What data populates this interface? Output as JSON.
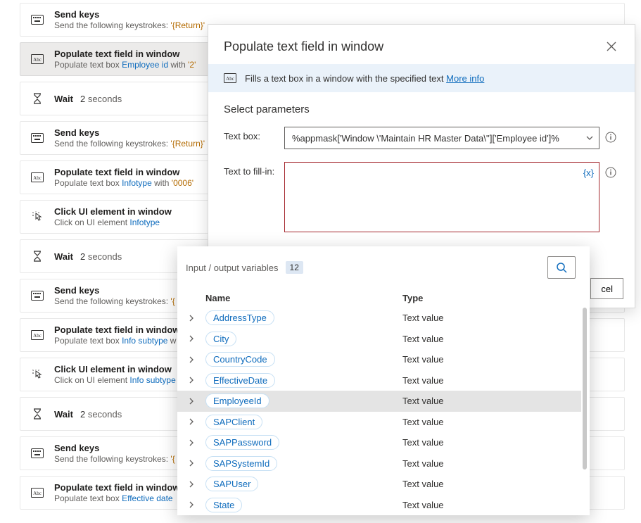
{
  "flow": [
    {
      "kind": "sendkeys",
      "title": "Send keys",
      "prefix": "Send the following keystrokes: ",
      "keys": "'{Return}'"
    },
    {
      "kind": "populate",
      "title": "Populate text field in window",
      "prefix": "Populate text box ",
      "link": "Employee id",
      "mid": " with ",
      "lit": "'2'",
      "selected": true
    },
    {
      "kind": "wait",
      "title": "Wait",
      "seconds": "2",
      "suffix": "seconds"
    },
    {
      "kind": "sendkeys",
      "title": "Send keys",
      "prefix": "Send the following keystrokes: ",
      "keys": "'{Return}'"
    },
    {
      "kind": "populate",
      "title": "Populate text field in window",
      "prefix": "Populate text box ",
      "link": "Infotype",
      "mid": " with ",
      "lit": "'0006'"
    },
    {
      "kind": "click",
      "title": "Click UI element in window",
      "prefix": "Click on UI element ",
      "link": "Infotype"
    },
    {
      "kind": "wait",
      "title": "Wait",
      "seconds": "2",
      "suffix": "seconds"
    },
    {
      "kind": "sendkeys",
      "title": "Send keys",
      "prefix": "Send the following keystrokes: ",
      "keys": "'{"
    },
    {
      "kind": "populate",
      "title": "Populate text field in window",
      "prefix": "Populate text box ",
      "link": "Info subtype",
      "mid": " w"
    },
    {
      "kind": "click",
      "title": "Click UI element in window",
      "prefix": "Click on UI element ",
      "link": "Info subtype"
    },
    {
      "kind": "wait",
      "title": "Wait",
      "seconds": "2",
      "suffix": "seconds"
    },
    {
      "kind": "sendkeys",
      "title": "Send keys",
      "prefix": "Send the following keystrokes: ",
      "keys": "'{"
    },
    {
      "kind": "populate",
      "title": "Populate text field in window",
      "prefix": "Populate text box ",
      "link": "Effective date",
      "mid": " "
    }
  ],
  "dialog": {
    "title": "Populate text field in window",
    "info_text": "Fills a text box in a window with the specified text",
    "more_info": "More info",
    "params_heading": "Select parameters",
    "label_textbox": "Text box:",
    "label_fill": "Text to fill-in:",
    "textbox_value": "%appmask['Window \\'Maintain HR Master Data\\'']['Employee id']%",
    "fill_value": "",
    "fx_label": "{x}",
    "cancel": "cel"
  },
  "variables": {
    "heading": "Input / output variables",
    "count": "12",
    "col_name": "Name",
    "col_type": "Type",
    "rows": [
      {
        "name": "AddressType",
        "type": "Text value"
      },
      {
        "name": "City",
        "type": "Text value"
      },
      {
        "name": "CountryCode",
        "type": "Text value"
      },
      {
        "name": "EffectiveDate",
        "type": "Text value"
      },
      {
        "name": "EmployeeId",
        "type": "Text value",
        "selected": true
      },
      {
        "name": "SAPClient",
        "type": "Text value"
      },
      {
        "name": "SAPPassword",
        "type": "Text value"
      },
      {
        "name": "SAPSystemId",
        "type": "Text value"
      },
      {
        "name": "SAPUser",
        "type": "Text value"
      },
      {
        "name": "State",
        "type": "Text value"
      }
    ]
  }
}
